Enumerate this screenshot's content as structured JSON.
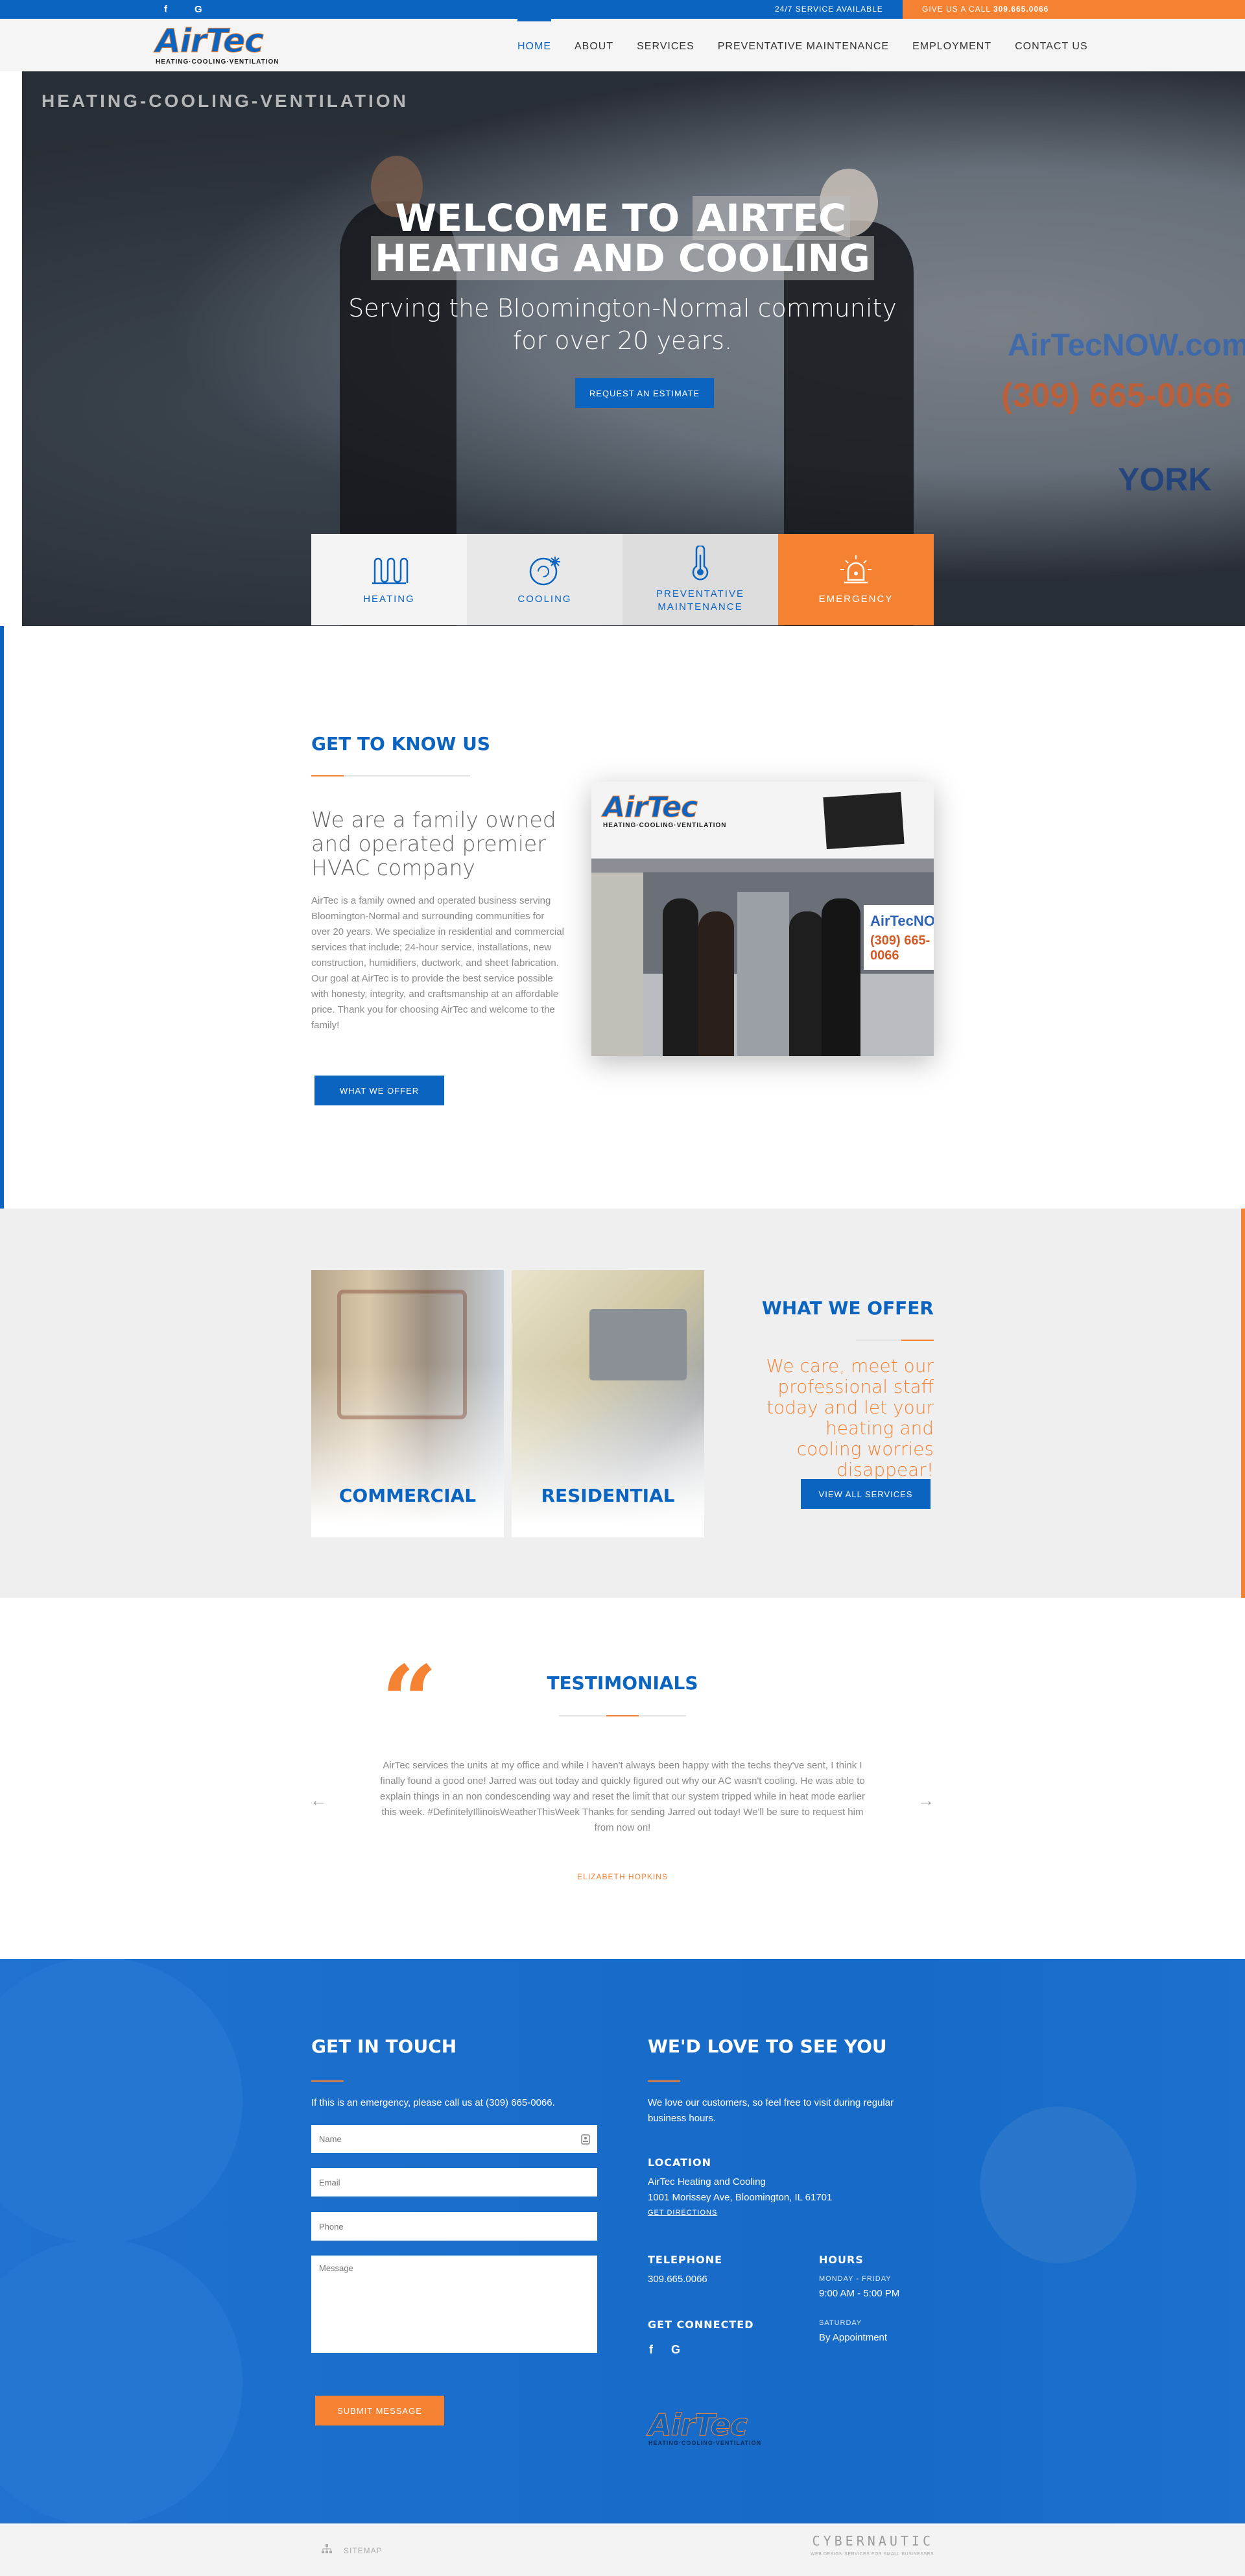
{
  "topbar": {
    "social_facebook": "f",
    "social_google": "G",
    "service_text": "24/7 SERVICE AVAILABLE",
    "call_label": "GIVE US A CALL",
    "call_number": "309.665.0066"
  },
  "logo": {
    "wordmark": "AirTec",
    "tagline": "HEATING·COOLING·VENTILATION"
  },
  "nav": [
    "HOME",
    "ABOUT",
    "SERVICES",
    "PREVENTATIVE MAINTENANCE",
    "EMPLOYMENT",
    "CONTACT US"
  ],
  "hero": {
    "title_line1_a": "WELCOME TO ",
    "title_line1_b": "AIRTEC",
    "title_line2": "HEATING AND COOLING",
    "subtitle": "Serving the Bloomington-Normal community for over 20 years.",
    "button": "REQUEST AN ESTIMATE",
    "sign_text": "HEATING-COOLING-VENTILATION",
    "brand_web": "AirTecNOW.com",
    "brand_phone": "(309) 665-0066",
    "brand_york": "YORK"
  },
  "service_boxes": [
    {
      "label": "HEATING",
      "icon": "heating-icon"
    },
    {
      "label": "COOLING",
      "icon": "cooling-icon"
    },
    {
      "label": "PREVENTATIVE MAINTENANCE",
      "icon": "thermometer-icon"
    },
    {
      "label": "EMERGENCY",
      "icon": "emergency-icon"
    }
  ],
  "about": {
    "heading": "GET TO KNOW US",
    "lead": "We are a family owned and operated premier HVAC company",
    "body": "AirTec is a family owned and operated business serving Bloomington-Normal and surrounding communities for over 20 years. We specialize in residential and commercial services that include; 24-hour service, installations, new construction, humidifiers, ductwork, and sheet fabrication. Our goal at AirTec is to provide the best service possible with honesty, integrity, and craftsmanship at an affordable price. Thank you for choosing AirTec and welcome to the family!",
    "button": "WHAT WE OFFER"
  },
  "offer": {
    "card_commercial": "COMMERCIAL",
    "card_residential": "RESIDENTIAL",
    "heading": "WHAT WE OFFER",
    "lead": "We care, meet our professional staff today and let your heating and cooling worries disappear!",
    "button": "VIEW ALL SERVICES"
  },
  "testimonials": {
    "heading": "TESTIMONIALS",
    "text": "AirTec services the units at my office and while I haven't always been happy with the techs they've sent, I think I finally found a good one! Jarred was out today and quickly figured out why our AC wasn't cooling. He was able to explain things in an non condescending way and reset the limit that our system tripped while in heat mode earlier this week. #DefinitelyIllinoisWeatherThisWeek Thanks for sending Jarred out today! We'll be sure to request him from now on!",
    "author": "ELIZABETH HOPKINS",
    "prev": "←",
    "next": "→"
  },
  "contact": {
    "heading": "GET IN TOUCH",
    "intro": "If this is an emergency, please call us at (309) 665-0066.",
    "name_placeholder": "Name",
    "email_placeholder": "Email",
    "phone_placeholder": "Phone",
    "message_placeholder": "Message",
    "submit": "SUBMIT MESSAGE"
  },
  "visit": {
    "heading": "WE'D LOVE TO SEE YOU",
    "intro": "We love our customers, so feel free to visit during regular business hours.",
    "location_label": "LOCATION",
    "location_name": "AirTec Heating and Cooling",
    "location_address": "1001 Morissey Ave, Bloomington, IL 61701",
    "directions": "GET DIRECTIONS",
    "telephone_label": "TELEPHONE",
    "telephone": "309.665.0066",
    "hours_label": "HOURS",
    "weekday_label": "MONDAY - FRIDAY",
    "weekday_hours": "9:00 AM - 5:00 PM",
    "saturday_label": "SATURDAY",
    "saturday_hours": "By Appointment",
    "connected_label": "GET CONNECTED",
    "social_facebook": "f",
    "social_google": "G"
  },
  "bottom": {
    "sitemap": "SITEMAP",
    "credit_name": "CYBERNAUTIC",
    "credit_tag": "WEB DESIGN SERVICES FOR SMALL BUSINESSES"
  },
  "colors": {
    "brand_blue": "#0b64c0",
    "accent_orange": "#f58233"
  }
}
